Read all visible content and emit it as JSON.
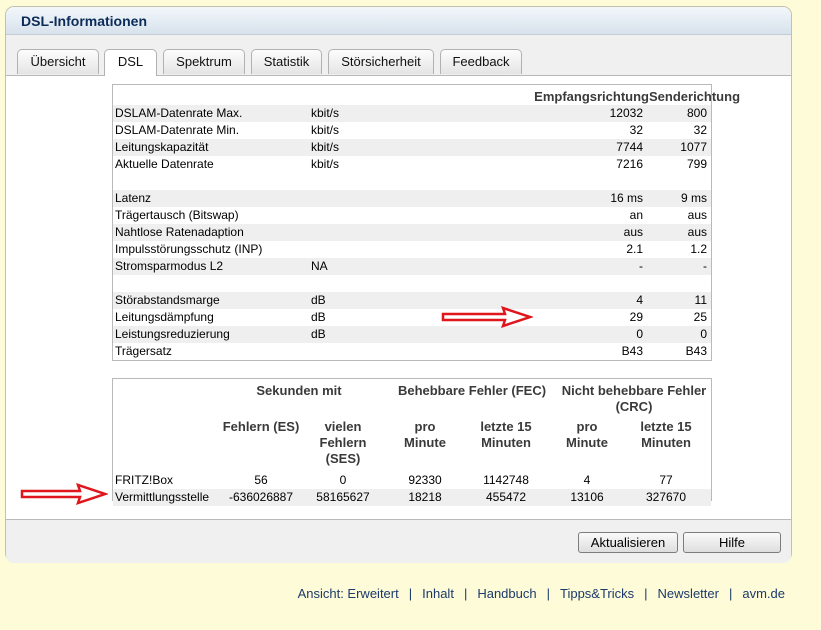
{
  "panel": {
    "title": "DSL-Informationen"
  },
  "tabs": [
    {
      "label": "Übersicht"
    },
    {
      "label": "DSL",
      "active": true
    },
    {
      "label": "Spektrum"
    },
    {
      "label": "Statistik"
    },
    {
      "label": "Störsicherheit"
    },
    {
      "label": "Feedback"
    }
  ],
  "dsl_table": {
    "col_receive": "Empfangsrichtung",
    "col_send": "Senderichtung",
    "rows": [
      {
        "label": "DSLAM-Datenrate Max.",
        "unit": "kbit/s",
        "rx": "12032",
        "tx": "800"
      },
      {
        "label": "DSLAM-Datenrate Min.",
        "unit": "kbit/s",
        "rx": "32",
        "tx": "32"
      },
      {
        "label": "Leitungskapazität",
        "unit": "kbit/s",
        "rx": "7744",
        "tx": "1077"
      },
      {
        "label": "Aktuelle Datenrate",
        "unit": "kbit/s",
        "rx": "7216",
        "tx": "799"
      },
      {
        "label": "Latenz",
        "unit": "",
        "rx": "16 ms",
        "tx": "9 ms"
      },
      {
        "label": "Trägertausch (Bitswap)",
        "unit": "",
        "rx": "an",
        "tx": "aus"
      },
      {
        "label": "Nahtlose Ratenadaption",
        "unit": "",
        "rx": "aus",
        "tx": "aus"
      },
      {
        "label": "Impulsstörungsschutz (INP)",
        "unit": "",
        "rx": "2.1",
        "tx": "1.2"
      },
      {
        "label": "Stromsparmodus L2",
        "unit": "NA",
        "rx": "-",
        "tx": "-"
      },
      {
        "label": "Störabstandsmarge",
        "unit": "dB",
        "rx": "4",
        "tx": "11"
      },
      {
        "label": "Leitungsdämpfung",
        "unit": "dB",
        "rx": "29",
        "tx": "25"
      },
      {
        "label": "Leistungsreduzierung",
        "unit": "dB",
        "rx": "0",
        "tx": "0"
      },
      {
        "label": "Trägersatz",
        "unit": "",
        "rx": "B43",
        "tx": "B43"
      }
    ]
  },
  "error_table": {
    "group_seconds": "Sekunden mit",
    "group_fec": "Behebbare Fehler (FEC)",
    "group_crc": "Nicht behebbare Fehler (CRC)",
    "sub": {
      "es": "Fehlern (ES)",
      "ses": "vielen Fehlern (SES)",
      "fec_min": "pro Minute",
      "fec_15": "letzte 15 Minuten",
      "crc_min": "pro Minute",
      "crc_15": "letzte 15 Minuten"
    },
    "rows": [
      {
        "label": "FRITZ!Box",
        "es": "56",
        "ses": "0",
        "fec_min": "92330",
        "fec_15": "1142748",
        "crc_min": "4",
        "crc_15": "77"
      },
      {
        "label": "Vermittlungsstelle",
        "es": "-636026887",
        "ses": "58165627",
        "fec_min": "18218",
        "fec_15": "455472",
        "crc_min": "13106",
        "crc_15": "327670"
      }
    ]
  },
  "buttons": {
    "refresh": "Aktualisieren",
    "help": "Hilfe"
  },
  "footer": {
    "links": [
      "Ansicht: Erweitert",
      "Inhalt",
      "Handbuch",
      "Tipps&Tricks",
      "Newsletter",
      "avm.de"
    ],
    "separator": "|"
  },
  "annotations": {
    "arrow_color": "#e0161d"
  }
}
